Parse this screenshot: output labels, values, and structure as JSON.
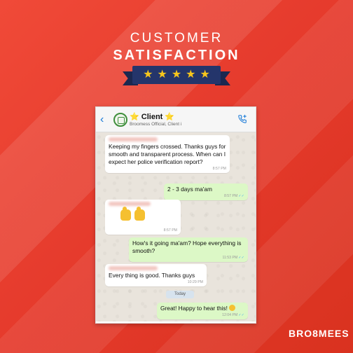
{
  "banner": {
    "line1": "CUSTOMER",
    "line2": "SATISFACTION",
    "stars": [
      "★",
      "★",
      "★",
      "★",
      "★"
    ],
    "colors": {
      "background": "#e8392b",
      "ribbon": "#24356b",
      "star": "#f7c61c"
    }
  },
  "chat": {
    "header": {
      "back_icon": "chevron-left-icon",
      "contact_name": "Client",
      "contact_star_left": "⭐",
      "contact_star_right": "⭐",
      "subtitle": "Broomess Official, Client i",
      "call_icon": "phone-plus-icon"
    },
    "messages": [
      {
        "direction": "in",
        "text": "Keeping my fingers crossed. Thanks guys for smooth and transparent process. When can I expect her police verification report?",
        "time": "8:57 PM"
      },
      {
        "direction": "out",
        "text": "2 - 3 days ma'am",
        "time": "8:57 PM"
      },
      {
        "direction": "in",
        "text": "",
        "emoji": "thumbs-up",
        "time": "8:57 PM"
      },
      {
        "direction": "out",
        "text": "How's it going ma'am? Hope everything is smooth?",
        "time": "11:53 PM"
      },
      {
        "direction": "in",
        "text": "Every thing is good. Thanks guys",
        "time": "10:29 PM"
      },
      {
        "direction": "out",
        "text": "Great! Happy to hear this!",
        "time": "12:04 PM"
      }
    ],
    "day_separator": "Today"
  },
  "brand": {
    "logo_text": "BRO",
    "logo_text2": "MEES"
  }
}
